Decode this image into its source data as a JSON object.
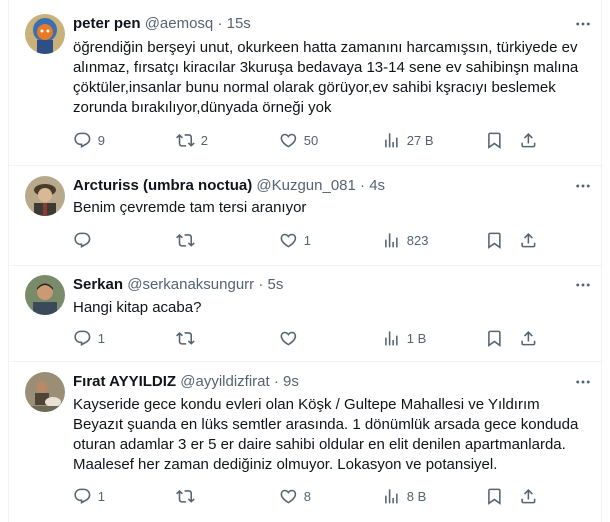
{
  "tweets": [
    {
      "name": "peter pen",
      "handle": "@aemosq",
      "sep": "·",
      "time": "15s",
      "text": "öğrendiğin berşeyi unut, okurkeen hatta zamanını harcamışsın, türkiyede ev\nalınmaz, fırsatçı kiracılar 3kuruşa bedavaya 13-14 sene ev sahibinşn malına\nçöktüler,insanlar bunu normal olarak görüyor,ev sahibi kşracıyı beslemek\nzorunda bırakılıyor,dünyada örneği yok",
      "replies": "9",
      "retweets": "2",
      "likes": "50",
      "views": "27 B"
    },
    {
      "name": "Arcturiss (umbra noctua)",
      "handle": "@Kuzgun_081",
      "sep": "·",
      "time": "4s",
      "text": "Benim çevremde tam tersi aranıyor",
      "replies": "",
      "retweets": "",
      "likes": "1",
      "views": "823"
    },
    {
      "name": "Serkan",
      "handle": "@serkanaksungurr",
      "sep": "·",
      "time": "5s",
      "text": "Hangi kitap acaba?",
      "replies": "1",
      "retweets": "",
      "likes": "",
      "views": "1 B"
    },
    {
      "name": "Fırat AYYILDIZ",
      "handle": "@ayyildizfirat",
      "sep": "·",
      "time": "9s",
      "text": "Kayseride gece kondu evleri olan Köşk / Gultepe Mahallesi ve Yıldırım\nBeyazıt şuanda en lüks semtler arasında. 1 dönümlük arsada gece konduda\noturan adamlar 3 er 5 er daire sahibi oldular en elit denilen apartmanlarda.\nMaalesef her zaman dediğiniz olmuyor. Lokasyon ve potansiyel.",
      "replies": "1",
      "retweets": "",
      "likes": "8",
      "views": "8 B"
    }
  ],
  "icons": {
    "reply": "reply-icon",
    "retweet": "retweet-icon",
    "like": "heart-icon",
    "views": "views-icon",
    "bookmark": "bookmark-icon",
    "share": "share-icon",
    "more": "more-icon"
  },
  "colors": {
    "text": "#0f1419",
    "secondary": "#536471",
    "divider": "#eff3f4"
  }
}
